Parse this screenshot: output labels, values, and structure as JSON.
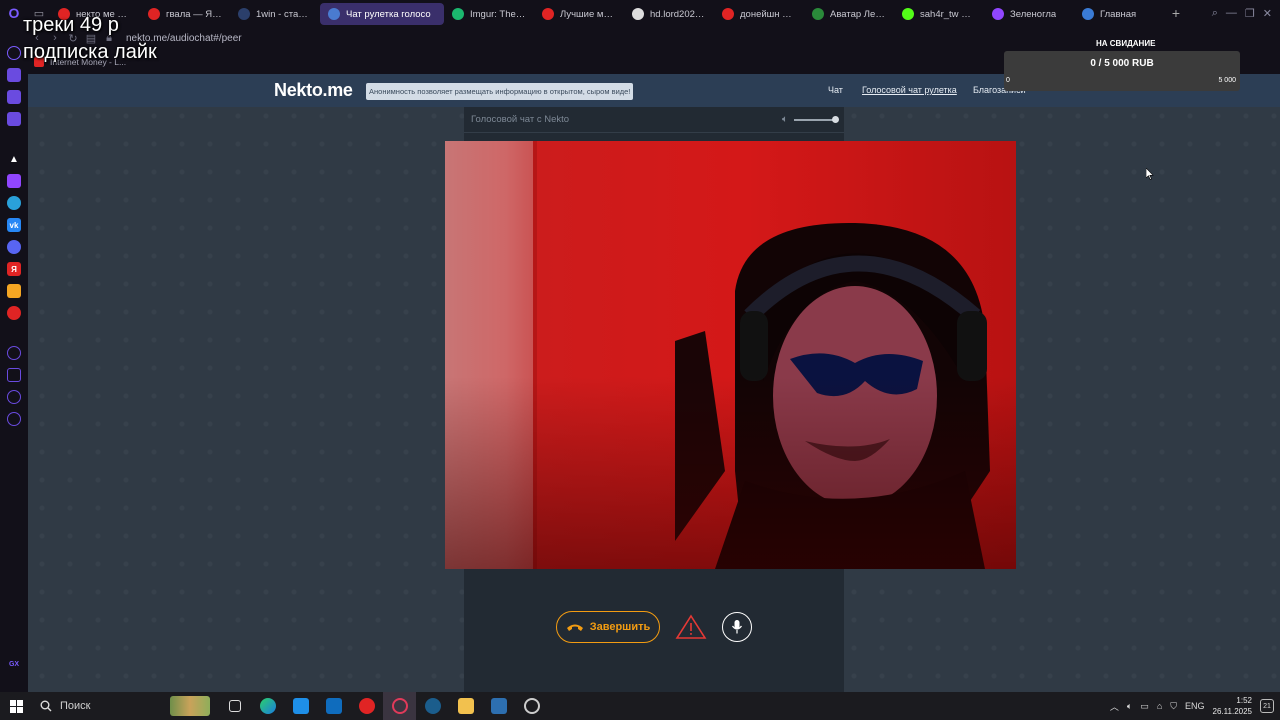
{
  "browser": {
    "tabs": [
      {
        "label": "некто ме — Ян",
        "color": "#e02424",
        "icon": "yandex-icon"
      },
      {
        "label": "гвала — Яндекс",
        "color": "#e02424",
        "icon": "yandex-icon"
      },
      {
        "label": "1win - ставки н",
        "color": "#2b3f6b",
        "icon": "1win-icon"
      },
      {
        "label": "Чат рулетка голосо",
        "color": "#4a7bd0",
        "icon": "speaker-icon",
        "active": true
      },
      {
        "label": "Imgur: The ma",
        "color": "#1bb76e",
        "icon": "imgur-icon"
      },
      {
        "label": "Лучшие моме",
        "color": "#e02424",
        "icon": "youtube-icon"
      },
      {
        "label": "hd.lord2026.ru",
        "color": "#dddddd",
        "icon": "film-icon"
      },
      {
        "label": "донейшн алер",
        "color": "#e02424",
        "icon": "yandex-icon"
      },
      {
        "label": "Аватар Леген",
        "color": "#2a8a3a",
        "icon": "avatar-icon"
      },
      {
        "label": "sah4r_tw Strea",
        "color": "#53fc18",
        "icon": "kick-icon"
      },
      {
        "label": "Зеленогла",
        "color": "#9146ff",
        "icon": "twitch-icon"
      },
      {
        "label": "Главная",
        "color": "#3a7bd5",
        "icon": "home-icon"
      }
    ],
    "url": "nekto.me/audiochat#/peer",
    "bookmark_label": "Internet Money - L..."
  },
  "site": {
    "logo": "Nekto.me",
    "notice": "Анонимность позволяет размещать информацию в открытом, сыром виде!",
    "nav": {
      "chat": "Чат",
      "voice": "Голосовой чат рулетка",
      "blog": "Благозаписи"
    },
    "chat_title": "Голосовой чат с Nekto",
    "end_button": "Завершить"
  },
  "overlay": {
    "line1": "треки 49 р",
    "line2": "подписка лайк"
  },
  "donation": {
    "title": "НА СВИДАНИЕ",
    "amount": "0 / 5 000 RUB",
    "min": "0",
    "max": "5 000",
    "progress": 0
  },
  "taskbar": {
    "search_placeholder": "Поиск",
    "language": "ENG",
    "time": "1:52",
    "date": "26.11.2025",
    "notifications": "21"
  }
}
